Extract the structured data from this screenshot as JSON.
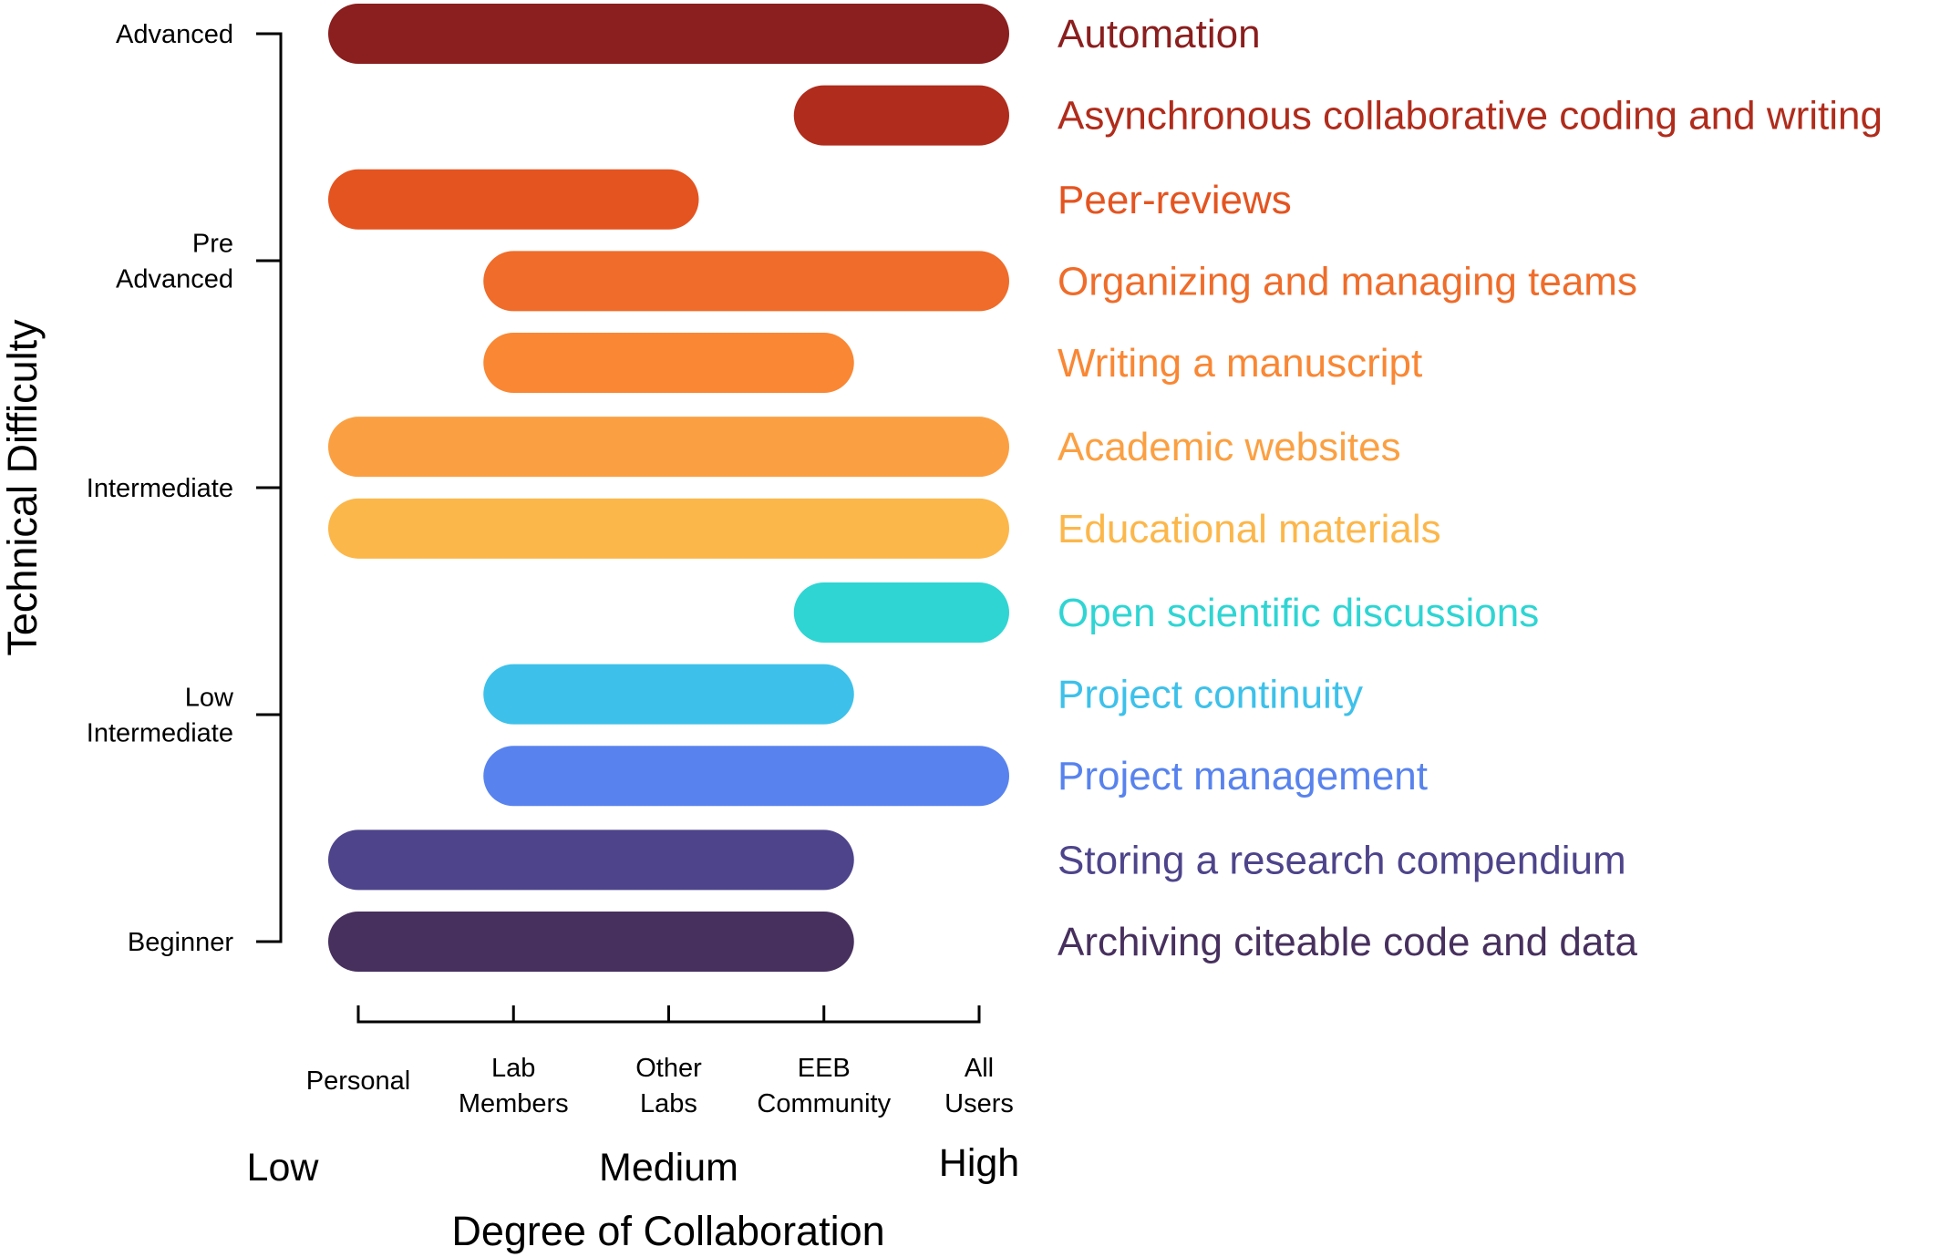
{
  "chart_data": {
    "type": "bar",
    "subtype": "horizontal-range",
    "title": "",
    "xlabel": "Degree of Collaboration",
    "ylabel": "Technical Difficulty",
    "x_categories": [
      "Personal",
      "Lab Members",
      "Other Labs",
      "EEB Community",
      "All Users"
    ],
    "x_category_lines": [
      [
        "Personal"
      ],
      [
        "Lab",
        "Members"
      ],
      [
        "Other",
        "Labs"
      ],
      [
        "EEB",
        "Community"
      ],
      [
        "All",
        "Users"
      ]
    ],
    "x_levels": [
      {
        "label": "Low",
        "at": "Personal"
      },
      {
        "label": "Medium",
        "at": "Other Labs"
      },
      {
        "label": "High",
        "at": "All Users"
      }
    ],
    "y_levels": [
      {
        "lines": [
          "Advanced"
        ],
        "value": 4
      },
      {
        "lines": [
          "Pre",
          "Advanced"
        ],
        "value": 3
      },
      {
        "lines": [
          "Intermediate"
        ],
        "value": 2
      },
      {
        "lines": [
          "Low",
          "Intermediate"
        ],
        "value": 1
      },
      {
        "lines": [
          "Beginner"
        ],
        "value": 0
      }
    ],
    "ylim": [
      0,
      4
    ],
    "grid": false,
    "legend": "none (labels at right of each bar)",
    "series": [
      {
        "name": "Automation",
        "start": "Personal",
        "end": "All Users",
        "difficulty": 4.0,
        "color": "#8B1E1E"
      },
      {
        "name": "Asynchronous collaborative coding and writing",
        "start": "EEB Community",
        "end": "All Users",
        "difficulty": 3.64,
        "color": "#B02C1C"
      },
      {
        "name": "Peer-reviews",
        "start": "Personal",
        "end": "Other Labs",
        "difficulty": 3.27,
        "color": "#E45420"
      },
      {
        "name": "Organizing and managing teams",
        "start": "Lab Members",
        "end": "All Users",
        "difficulty": 2.91,
        "color": "#EF6C2A"
      },
      {
        "name": "Writing a manuscript",
        "start": "Lab Members",
        "end": "EEB Community",
        "difficulty": 2.55,
        "color": "#F98734"
      },
      {
        "name": "Academic websites",
        "start": "Personal",
        "end": "All Users",
        "difficulty": 2.18,
        "color": "#FBA042"
      },
      {
        "name": "Educational materials",
        "start": "Personal",
        "end": "All Users",
        "difficulty": 1.82,
        "color": "#FCB74A"
      },
      {
        "name": "Open scientific discussions",
        "start": "EEB Community",
        "end": "All Users",
        "difficulty": 1.45,
        "color": "#2FD5D3"
      },
      {
        "name": "Project continuity",
        "start": "Lab Members",
        "end": "EEB Community",
        "difficulty": 1.09,
        "color": "#3DC1EA"
      },
      {
        "name": "Project management",
        "start": "Lab Members",
        "end": "All Users",
        "difficulty": 0.73,
        "color": "#5883EE"
      },
      {
        "name": "Storing a research compendium",
        "start": "Personal",
        "end": "EEB Community",
        "difficulty": 0.36,
        "color": "#4E448B"
      },
      {
        "name": "Archiving citeable code and data",
        "start": "Personal",
        "end": "EEB Community",
        "difficulty": 0.0,
        "color": "#47305E"
      }
    ]
  }
}
